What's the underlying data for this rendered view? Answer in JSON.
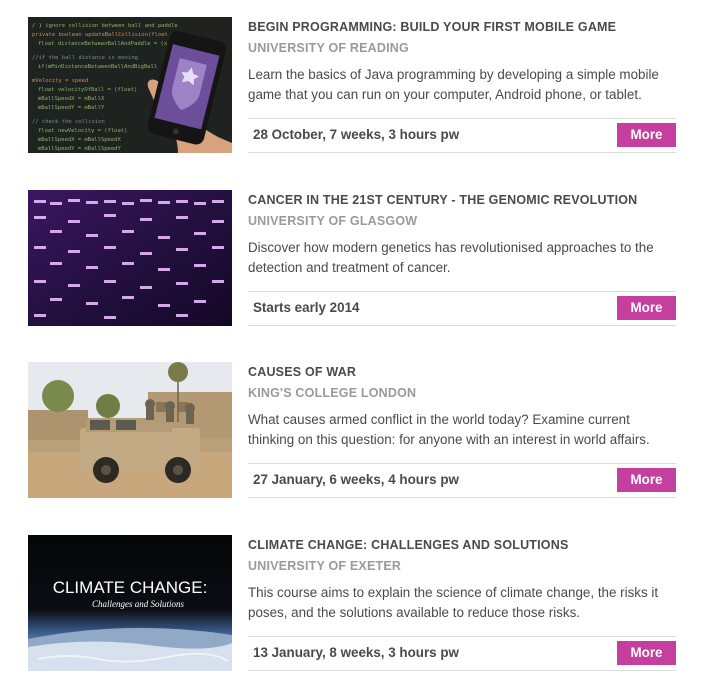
{
  "courses": [
    {
      "title": "BEGIN PROGRAMMING: BUILD YOUR FIRST MOBILE GAME",
      "university": "UNIVERSITY OF READING",
      "description": "Learn the basics of Java programming by developing a simple mobile game that you can run on your computer, Android phone, or tablet.",
      "meta": "28 October, 7 weeks, 3 hours pw",
      "more_label": "More",
      "image": "phone-code-image"
    },
    {
      "title": "CANCER IN THE 21ST CENTURY - THE GENOMIC REVOLUTION",
      "university": "UNIVERSITY OF GLASGOW",
      "description": "Discover how modern genetics has revolutionised approaches to the detection and treatment of cancer.",
      "meta": "Starts early 2014",
      "more_label": "More",
      "image": "dna-gel-image"
    },
    {
      "title": "CAUSES OF WAR",
      "university": "KING'S COLLEGE LONDON",
      "description": "What causes armed conflict in the world today? Examine current thinking on this question: for anyone with an interest in world affairs.",
      "meta": "27 January, 6 weeks, 4 hours pw",
      "more_label": "More",
      "image": "military-vehicle-image"
    },
    {
      "title": "CLIMATE CHANGE: CHALLENGES AND SOLUTIONS",
      "university": "UNIVERSITY OF EXETER",
      "description": "This course aims to explain the science of climate change, the risks it poses, and the solutions available to reduce those risks.",
      "meta": "13 January, 8 weeks, 3 hours pw",
      "more_label": "More",
      "image": "earth-horizon-image",
      "image_caption_title": "CLIMATE CHANGE:",
      "image_caption_subtitle": "Challenges and Solutions"
    }
  ],
  "colors": {
    "more_button": "#c43f9e",
    "university_text": "#9a9a9a",
    "body_text": "#4a4a4a",
    "divider": "#dcdcdc"
  }
}
